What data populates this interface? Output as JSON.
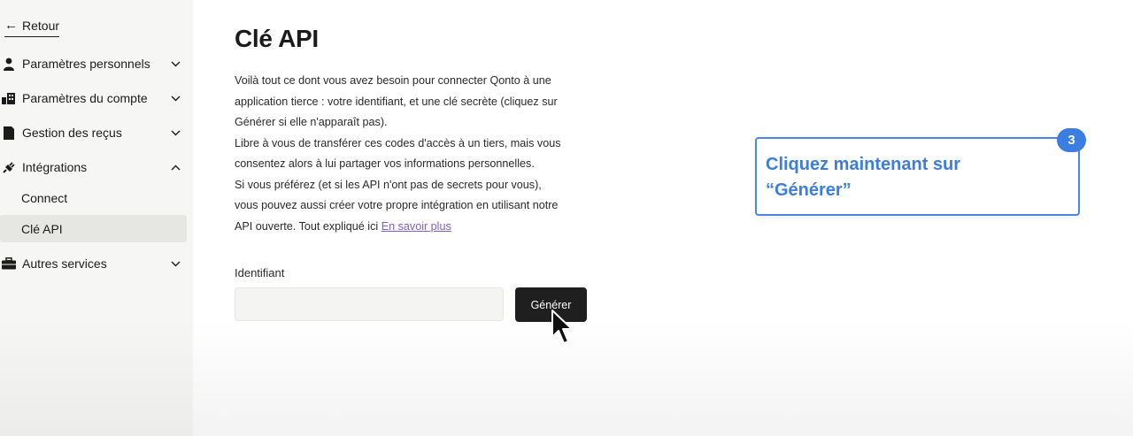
{
  "sidebar": {
    "back_label": "Retour",
    "items": [
      {
        "label": "Paramètres personnels",
        "icon": "person-icon",
        "expanded": false
      },
      {
        "label": "Paramètres du compte",
        "icon": "building-icon",
        "expanded": false
      },
      {
        "label": "Gestion des reçus",
        "icon": "receipt-icon",
        "expanded": false
      },
      {
        "label": "Intégrations",
        "icon": "plug-icon",
        "expanded": true
      },
      {
        "label": "Autres services",
        "icon": "briefcase-icon",
        "expanded": false
      }
    ],
    "sub_items": [
      {
        "label": "Connect",
        "active": false
      },
      {
        "label": "Clé API",
        "active": true
      }
    ]
  },
  "main": {
    "title": "Clé API",
    "paragraph_lines": [
      "Voilà tout ce dont vous avez besoin pour connecter Qonto à une",
      "application tierce : votre identifiant, et une clé secrète (cliquez sur",
      "Générer si elle n'apparaît pas).",
      "Libre à vous de transférer ces codes d'accès à un tiers, mais vous",
      "consentez alors à lui partager vos informations personnelles.",
      "Si vous préférez (et si les API n'ont pas de secrets pour vous),",
      "vous pouvez aussi créer votre propre intégration en utilisant notre",
      "API ouverte. Tout expliqué ici"
    ],
    "learn_more_link": "En savoir plus",
    "identifier_label": "Identifiant",
    "identifier_value": "",
    "generate_button": "Générer"
  },
  "callout": {
    "step_number": "3",
    "line1": "Cliquez maintenant sur",
    "line2": "“Générer”",
    "color": "#3b7de0"
  }
}
